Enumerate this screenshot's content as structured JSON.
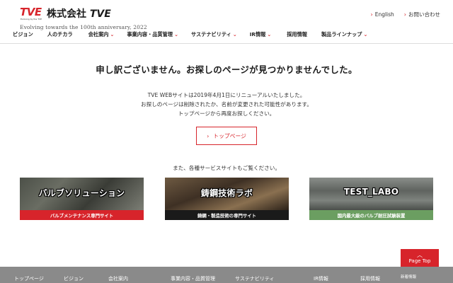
{
  "header": {
    "logo_mark": "TVE",
    "logo_sub": "Evolving by the TVE",
    "logo_name_prefix": "株式会社",
    "logo_name_suffix": "TVE",
    "tagline": "Evolving towards the 100th anniversary, 2022",
    "utility": [
      {
        "label": "English"
      },
      {
        "label": "お問い合わせ"
      }
    ],
    "nav": [
      {
        "label": "ビジョン",
        "dropdown": false
      },
      {
        "label": "人のチカラ",
        "dropdown": false
      },
      {
        "label": "会社案内",
        "dropdown": true
      },
      {
        "label": "事業内容・品質管理",
        "dropdown": true
      },
      {
        "label": "サステナビリティ",
        "dropdown": true
      },
      {
        "label": "IR情報",
        "dropdown": true
      },
      {
        "label": "採用情報",
        "dropdown": false
      },
      {
        "label": "製品ラインナップ",
        "dropdown": true
      }
    ]
  },
  "main": {
    "title": "申し訳ございません。お探しのページが見つかりませんでした。",
    "description": [
      "TVE WEBサイトは2019年4月1日にリニューアルいたしました。",
      "お探しのページは削除されたか、名前が変更された可能性があります。",
      "トップページから再度お探しください。"
    ],
    "top_button": "トップページ",
    "services_lead": "また、各種サービスサイトもご覧ください。",
    "banners": [
      {
        "title": "バルブソリューション",
        "caption": "バルブメンテナンス専門サイト"
      },
      {
        "title": "鋳鋼技術ラボ",
        "caption": "鋳鋼・製造技術の専門サイト"
      },
      {
        "title": "TEST_LABO",
        "caption": "国内最大級のバルブ耐圧試験装置"
      }
    ]
  },
  "page_top": "Page Top",
  "footer": {
    "nav": [
      {
        "label": "トップページ"
      },
      {
        "label": "ビジョン"
      },
      {
        "label": "会社案内"
      },
      {
        "label": "事業内容・品質管理"
      },
      {
        "label": "サステナビリティ"
      },
      {
        "label": "IR情報"
      },
      {
        "label": "採用情報"
      },
      {
        "label": "新着情報"
      }
    ]
  },
  "colors": {
    "brand_red": "#d7242b",
    "footer_gray": "#8a8a8a",
    "green_strip": "#6b9e61"
  }
}
